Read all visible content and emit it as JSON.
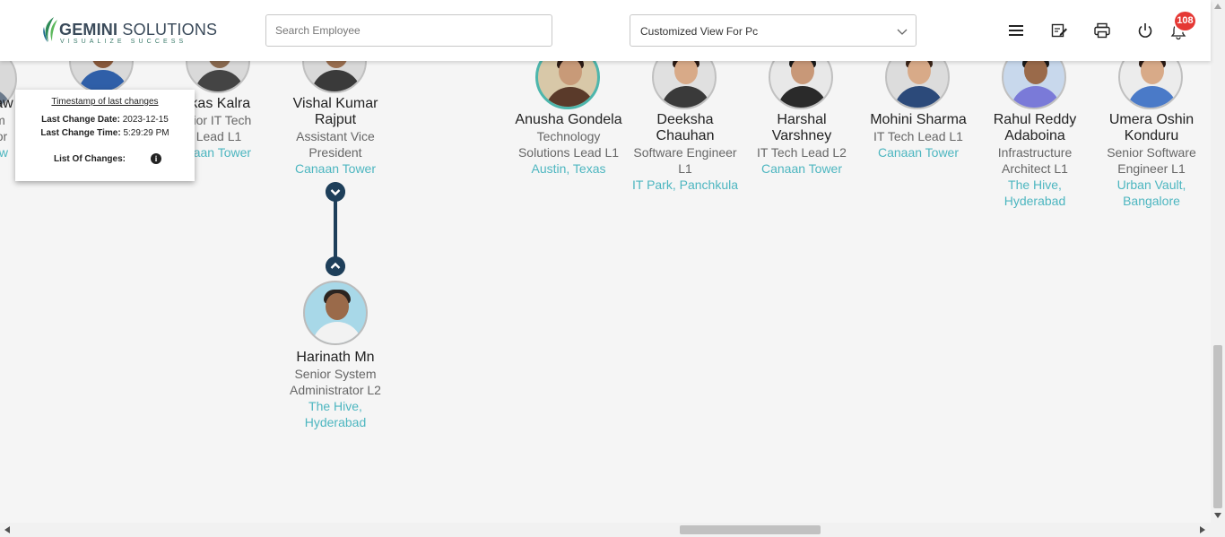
{
  "header": {
    "logo_brand": "GEMINI",
    "logo_word": "SOLUTIONS",
    "logo_tagline": "VISUALIZE SUCCESS",
    "search_placeholder": "Search Employee",
    "view_select_value": "Customized View For Pc",
    "icons": [
      "menu-icon",
      "edit-note-icon",
      "print-icon",
      "power-icon",
      "bell-icon"
    ],
    "notification_count": "108"
  },
  "tooltip": {
    "title": "Timestamp of last changes",
    "date_label": "Last Change Date:",
    "date_value": "2023-12-15",
    "time_label": "Last Change Time:",
    "time_value": "5:29:29 PM",
    "changes_label": "List Of Changes:"
  },
  "employees": [
    {
      "name": "naw",
      "role_lines": [
        "m",
        "tor"
      ],
      "location_lines": [
        "ow"
      ]
    },
    {
      "name": "",
      "role_lines": [],
      "location_lines": []
    },
    {
      "name": "ikas Kalra",
      "role_lines": [
        "nior IT Tech",
        "Lead L1"
      ],
      "location_lines": [
        "naan Tower"
      ]
    },
    {
      "name": "Vishal Kumar Rajput",
      "name_lines": [
        "Vishal Kumar",
        "Rajput"
      ],
      "role_lines": [
        "Assistant Vice",
        "President"
      ],
      "location_lines": [
        "Canaan Tower"
      ]
    },
    {
      "name": "Harinath Mn",
      "role_lines": [
        "Senior System",
        "Administrator L2"
      ],
      "location_lines": [
        "The Hive,",
        "Hyderabad"
      ]
    },
    {
      "name": "Anusha Gondela",
      "role_lines": [
        "Technology",
        "Solutions Lead L1"
      ],
      "location_lines": [
        "Austin, Texas"
      ]
    },
    {
      "name": "Deeksha Chauhan",
      "name_lines": [
        "Deeksha",
        "Chauhan"
      ],
      "role_lines": [
        "Software Engineer",
        "L1"
      ],
      "location_lines": [
        "IT Park, Panchkula"
      ]
    },
    {
      "name": "Harshal Varshney",
      "name_lines": [
        "Harshal",
        "Varshney"
      ],
      "role_lines": [
        "IT Tech Lead L2"
      ],
      "location_lines": [
        "Canaan Tower"
      ]
    },
    {
      "name": "Mohini Sharma",
      "role_lines": [
        "IT Tech Lead L1"
      ],
      "location_lines": [
        "Canaan Tower"
      ]
    },
    {
      "name": "Rahul Reddy Adaboina",
      "name_lines": [
        "Rahul Reddy",
        "Adaboina"
      ],
      "role_lines": [
        "Infrastructure",
        "Architect L1"
      ],
      "location_lines": [
        "The Hive,",
        "Hyderabad"
      ]
    },
    {
      "name": "Umera Oshin Konduru",
      "name_lines": [
        "Umera Oshin",
        "Konduru"
      ],
      "role_lines": [
        "Senior Software",
        "Engineer L1"
      ],
      "location_lines": [
        "Urban Vault,",
        "Bangalore"
      ]
    }
  ],
  "colors": {
    "accent_teal": "#4db6c0",
    "connector_navy": "#1e3f5a",
    "badge_red": "#e53935"
  }
}
